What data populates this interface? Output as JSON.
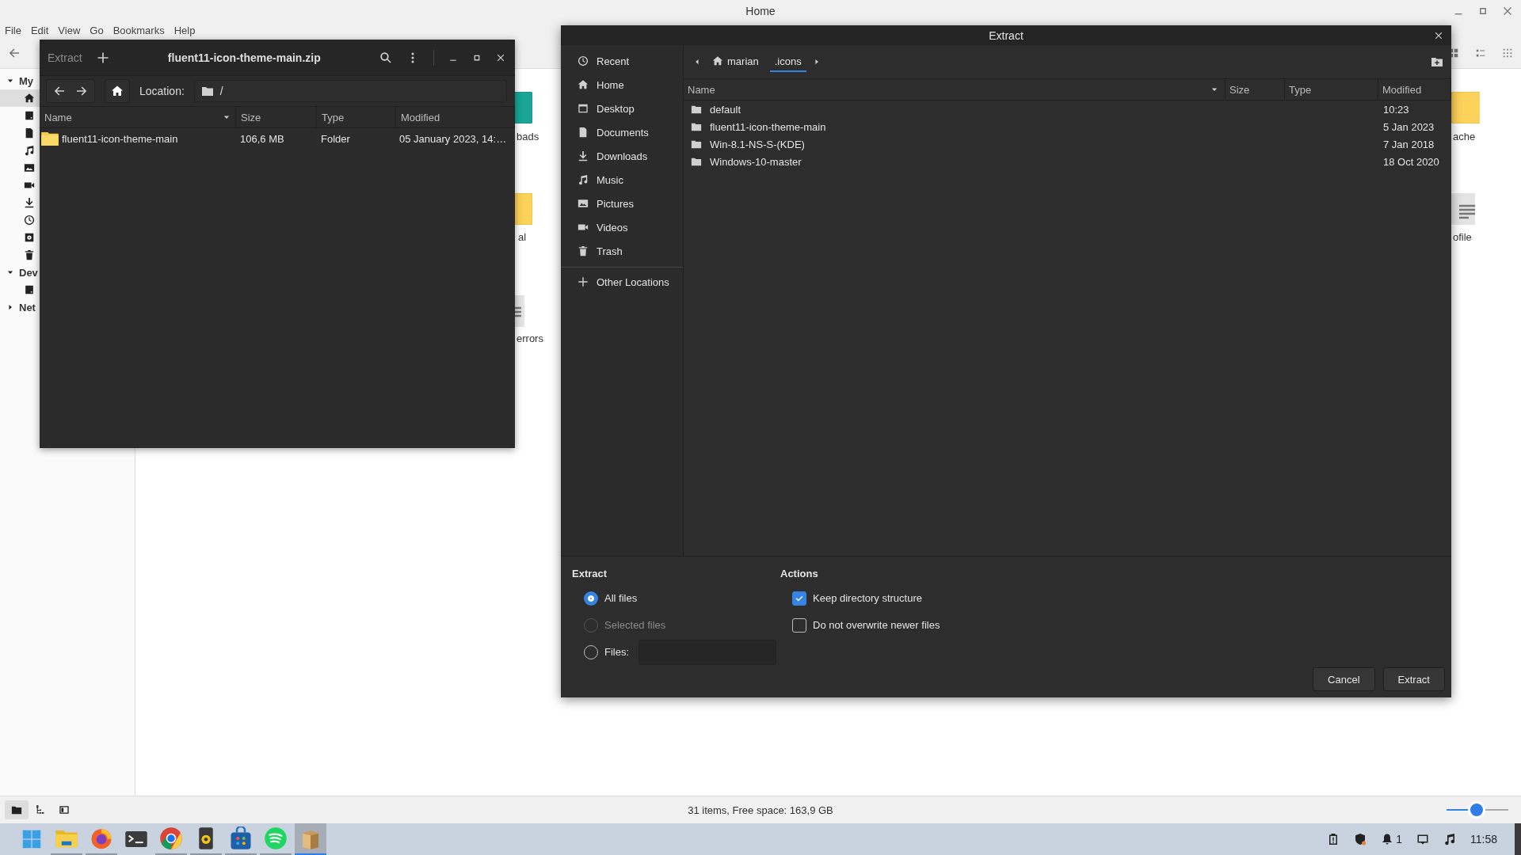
{
  "file_manager": {
    "title": "Home",
    "menu": [
      "File",
      "Edit",
      "View",
      "Go",
      "Bookmarks",
      "Help"
    ],
    "sidebar": [
      {
        "label": "My",
        "expanded": true,
        "items": [
          {
            "selected": true
          },
          {
            "selected": false
          },
          {
            "selected": false
          },
          {
            "selected": false
          },
          {
            "selected": false
          },
          {
            "selected": false
          },
          {
            "selected": false
          },
          {
            "selected": false
          },
          {
            "selected": false
          },
          {
            "selected": false
          }
        ]
      },
      {
        "label": "Dev",
        "expanded": true,
        "items": [
          {
            "selected": false
          }
        ]
      },
      {
        "label": "Net",
        "expanded": false
      }
    ],
    "partial_items": [
      {
        "label": "bads",
        "kind": "teal-folder"
      },
      {
        "label": "al",
        "kind": "folder"
      },
      {
        "label": "errors",
        "kind": "file"
      },
      {
        "label": "ache",
        "kind": "folder"
      },
      {
        "label": "ofile",
        "kind": "file"
      }
    ],
    "status_bar": "31 items, Free space: 163,9 GB",
    "zoom": {
      "level": 0.49
    }
  },
  "archive_window": {
    "title": "fluent11-icon-theme-main.zip",
    "extract_button": {
      "label": "Extract",
      "disabled": true
    },
    "location_label": "Location:",
    "location": "/",
    "columns": [
      "Name",
      "Size",
      "Type",
      "Modified"
    ],
    "rows": [
      {
        "name": "fluent11-icon-theme-main",
        "size": "106,6 MB",
        "type": "Folder",
        "modified": "05 January 2023, 14:…"
      }
    ]
  },
  "extract_dialog": {
    "title": "Extract",
    "places": [
      {
        "label": "Recent",
        "selected": false
      },
      {
        "label": "Home",
        "selected": false
      },
      {
        "label": "Desktop",
        "selected": false
      },
      {
        "label": "Documents",
        "selected": false
      },
      {
        "label": "Downloads",
        "selected": false
      },
      {
        "label": "Music",
        "selected": false
      },
      {
        "label": "Pictures",
        "selected": false
      },
      {
        "label": "Videos",
        "selected": false
      },
      {
        "label": "Trash",
        "selected": false
      }
    ],
    "other_locations": "Other Locations",
    "path": [
      {
        "label": "marian",
        "selected": false
      },
      {
        "label": ".icons",
        "selected": true
      }
    ],
    "columns": [
      "Name",
      "Size",
      "Type",
      "Modified"
    ],
    "rows": [
      {
        "name": "default",
        "modified": "10:23"
      },
      {
        "name": "fluent11-icon-theme-main",
        "modified": "5 Jan 2023"
      },
      {
        "name": "Win-8.1-NS-S-(KDE)",
        "modified": "7 Jan 2018"
      },
      {
        "name": "Windows-10-master",
        "modified": "18 Oct 2020"
      }
    ],
    "extract_group": {
      "title": "Extract",
      "options": [
        {
          "label": "All files",
          "selected": true,
          "disabled": false,
          "kind": "radio"
        },
        {
          "label": "Selected files",
          "selected": false,
          "disabled": true,
          "kind": "radio"
        },
        {
          "label": "Files:",
          "selected": false,
          "disabled": false,
          "kind": "field"
        }
      ]
    },
    "actions_group": {
      "title": "Actions",
      "options": [
        {
          "label": "Keep directory structure",
          "checked": true
        },
        {
          "label": "Do not overwrite newer files",
          "checked": false
        }
      ]
    },
    "buttons": [
      "Cancel",
      "Extract"
    ]
  },
  "taskbar": {
    "apps": [
      {
        "running": false,
        "selected": false
      },
      {
        "running": true,
        "selected": false
      },
      {
        "running": true,
        "selected": false
      },
      {
        "running": false,
        "selected": false
      },
      {
        "running": true,
        "selected": false
      },
      {
        "running": true,
        "selected": false
      },
      {
        "running": true,
        "selected": false
      },
      {
        "running": true,
        "selected": false
      },
      {
        "running": true,
        "selected": true
      }
    ],
    "notifications": "1",
    "clock": "11:58"
  }
}
